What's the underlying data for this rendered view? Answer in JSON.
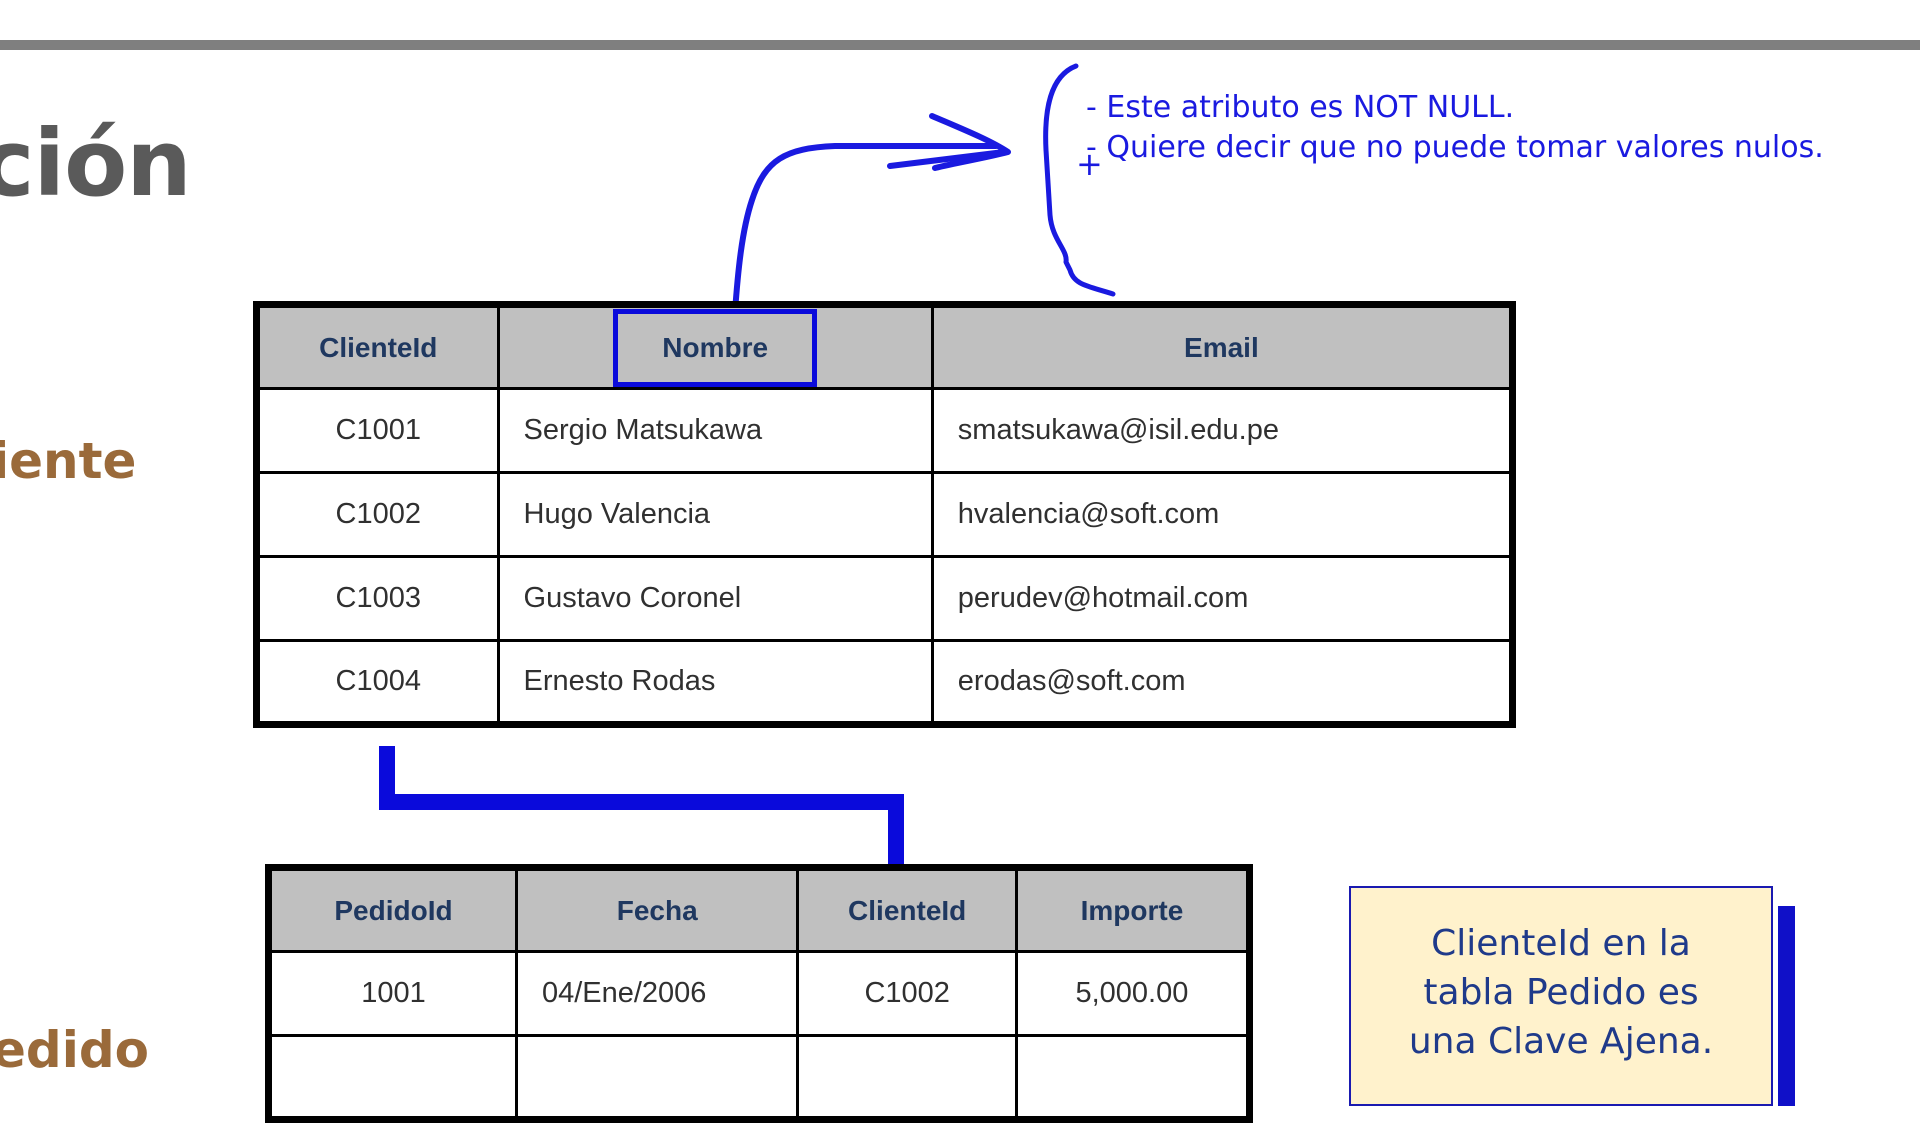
{
  "slide": {
    "title": "ción",
    "section_labels": [
      "iente",
      "edido"
    ]
  },
  "annotation": {
    "line1": "- Este atributo es NOT NULL.",
    "line2": "- Quiere decir que no puede tomar valores nulos.",
    "plus": "+"
  },
  "cliente_table": {
    "headers": [
      "ClienteId",
      "Nombre",
      "Email"
    ],
    "rows": [
      [
        "C1001",
        "Sergio Matsukawa",
        "smatsukawa@isil.edu.pe"
      ],
      [
        "C1002",
        "Hugo Valencia",
        "hvalencia@soft.com"
      ],
      [
        "C1003",
        "Gustavo Coronel",
        "perudev@hotmail.com"
      ],
      [
        "C1004",
        "Ernesto Rodas",
        "erodas@soft.com"
      ]
    ]
  },
  "pedido_table": {
    "headers": [
      "PedidoId",
      "Fecha",
      "ClienteId",
      "Importe"
    ],
    "rows": [
      [
        "1001",
        "04/Ene/2006",
        "C1002",
        "5,000.00"
      ],
      [
        "",
        "",
        "",
        ""
      ]
    ]
  },
  "note": {
    "line1": "ClienteId en la",
    "line2": "tabla Pedido es",
    "line3": "una Clave Ajena."
  },
  "colors": {
    "annotation_blue": "#1a1ae0",
    "header_gray": "#c0c0c0",
    "note_bg": "#fff2cc",
    "title_gray": "#5a5a5a",
    "section_brown": "#9a6a3a"
  }
}
